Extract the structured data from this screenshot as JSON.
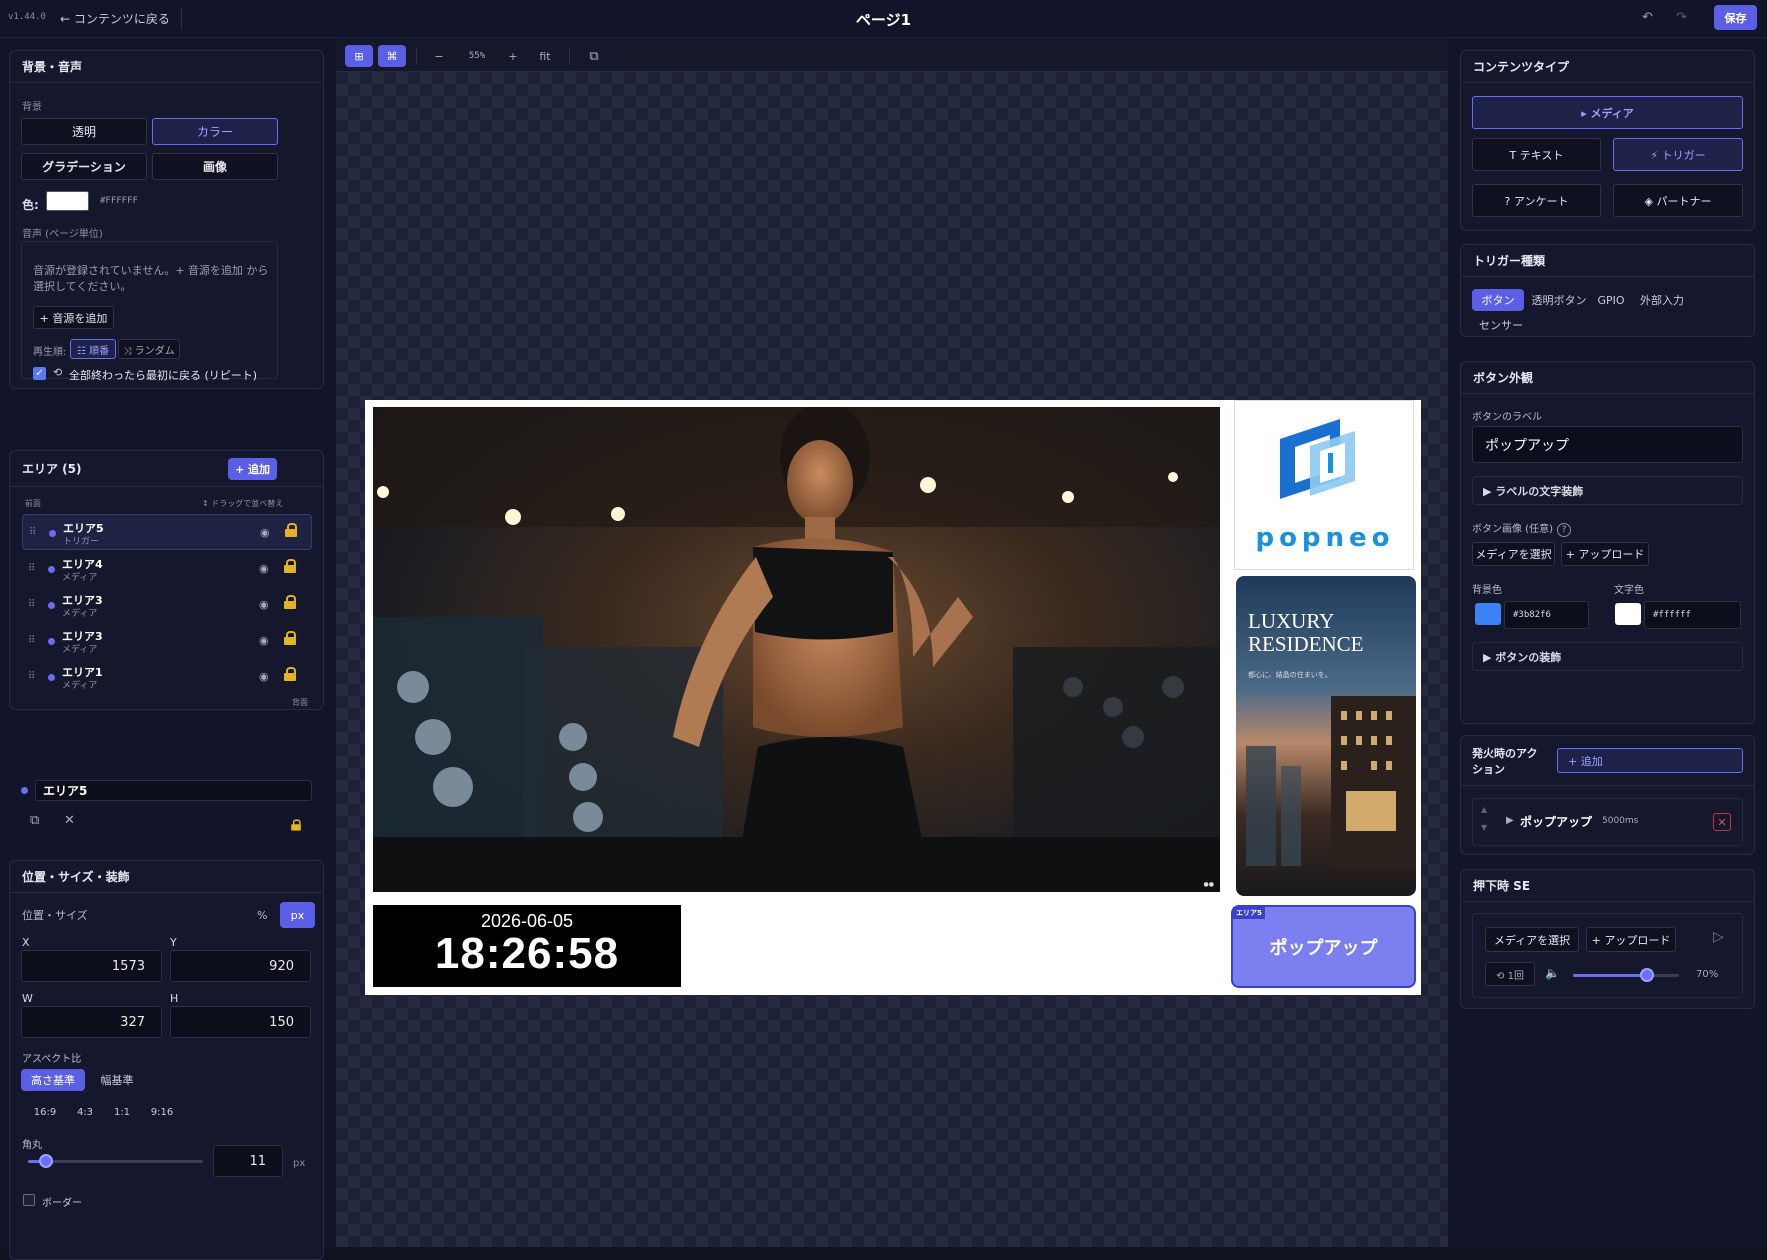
{
  "topbar": {
    "version": "v1.44.0",
    "back_label": "← コンテンツに戻る",
    "page_title": "ページ1",
    "undo": "↶",
    "redo": "↷",
    "save": "保存"
  },
  "left": {
    "bg_panel": {
      "title": "背景・音声",
      "bg_label": "背景",
      "bg_options": [
        "透明",
        "カラー",
        "グラデーション",
        "画像"
      ],
      "selected_bg": "カラー",
      "color_label": "色:",
      "color_value": "#FFFFFF",
      "audio_label": "音声 (ページ単位)",
      "audio_empty": "音源が登録されていません。+ 音源を追加 から選択してください。",
      "add_audio": "+ 音源を追加",
      "play_order_label": "再生順:",
      "order_seq": "☷ 順番",
      "order_random": "⤨ ランダム",
      "repeat_label": "全部終わったら最初に戻る (リピート)",
      "repeat_checked": true
    },
    "areas_panel": {
      "title": "エリア (5)",
      "add": "+ 追加",
      "front_label": "前面",
      "drag_hint": "↕ ドラッグで並べ替え",
      "back_label": "背面",
      "rows": [
        {
          "name": "エリア5",
          "type": "トリガー",
          "selected": true
        },
        {
          "name": "エリア4",
          "type": "メディア",
          "selected": false
        },
        {
          "name": "エリア3",
          "type": "メディア",
          "selected": false
        },
        {
          "name": "エリア3",
          "type": "メディア",
          "selected": false
        },
        {
          "name": "エリア1",
          "type": "メディア",
          "selected": false
        }
      ]
    },
    "selected_area": {
      "name": "エリア5"
    },
    "pos_panel": {
      "title": "位置・サイズ・装飾",
      "section_label": "位置・サイズ",
      "unit_percent": "%",
      "unit_px": "px",
      "x_label": "X",
      "x": "1573",
      "y_label": "Y",
      "y": "920",
      "w_label": "W",
      "w": "327",
      "h_label": "H",
      "h": "150",
      "aspect_label": "アスペクト比",
      "aspect_height": "高さ基準",
      "aspect_width": "幅基準",
      "ratios": [
        "16:9",
        "4:3",
        "1:1",
        "9:16"
      ],
      "radius_label": "角丸",
      "radius_value": "11",
      "radius_unit": "px",
      "radius_fraction": 0.1,
      "border_label": "ボーダー"
    }
  },
  "toolbar": {
    "zoom_out": "−",
    "zoom": "55%",
    "zoom_in": "+",
    "fit": "fit"
  },
  "stage": {
    "clock_date": "2026-06-05",
    "clock_time": "18:26:58",
    "logo_text": "popneo",
    "ad_title_line1": "LUXURY",
    "ad_title_line2": "RESIDENCE",
    "ad_sub": "都心に、結晶の住まいを。",
    "popup_tag": "エリア5",
    "popup_label": "ポップアップ"
  },
  "right": {
    "content_type": {
      "title": "コンテンツタイプ",
      "media": "▸ メディア",
      "text": "T テキスト",
      "trigger": "⚡ トリガー",
      "survey": "? アンケート",
      "partner": "◈ パートナー"
    },
    "trigger_type": {
      "title": "トリガー種類",
      "options": [
        "ボタン",
        "透明ボタン",
        "GPIO",
        "外部入力",
        "センサー"
      ],
      "selected": "ボタン"
    },
    "button_look": {
      "title": "ボタン外観",
      "label_label": "ボタンのラベル",
      "label_value": "ポップアップ",
      "label_deco": "▶ ラベルの文字装飾",
      "image_label": "ボタン画像 (任意)",
      "choose_media": "メディアを選択",
      "upload": "+ アップロード",
      "bg_color_label": "背景色",
      "bg_color": "#3b82f6",
      "text_color_label": "文字色",
      "text_color": "#ffffff",
      "button_deco": "▶ ボタンの装飾"
    },
    "actions": {
      "title": "発火時のアクション",
      "add": "+ 追加",
      "item_label": "ポップアップ",
      "item_duration": "5000ms"
    },
    "press_se": {
      "title": "押下時 SE",
      "choose_media": "メディアを選択",
      "upload": "+ アップロード",
      "repeat": "⟲ 1回",
      "volume": "70%",
      "volume_fraction": 0.7
    }
  },
  "colors": {
    "accent": "#5b5fe6",
    "panel": "#15172c",
    "lock": "#e4b41e"
  }
}
